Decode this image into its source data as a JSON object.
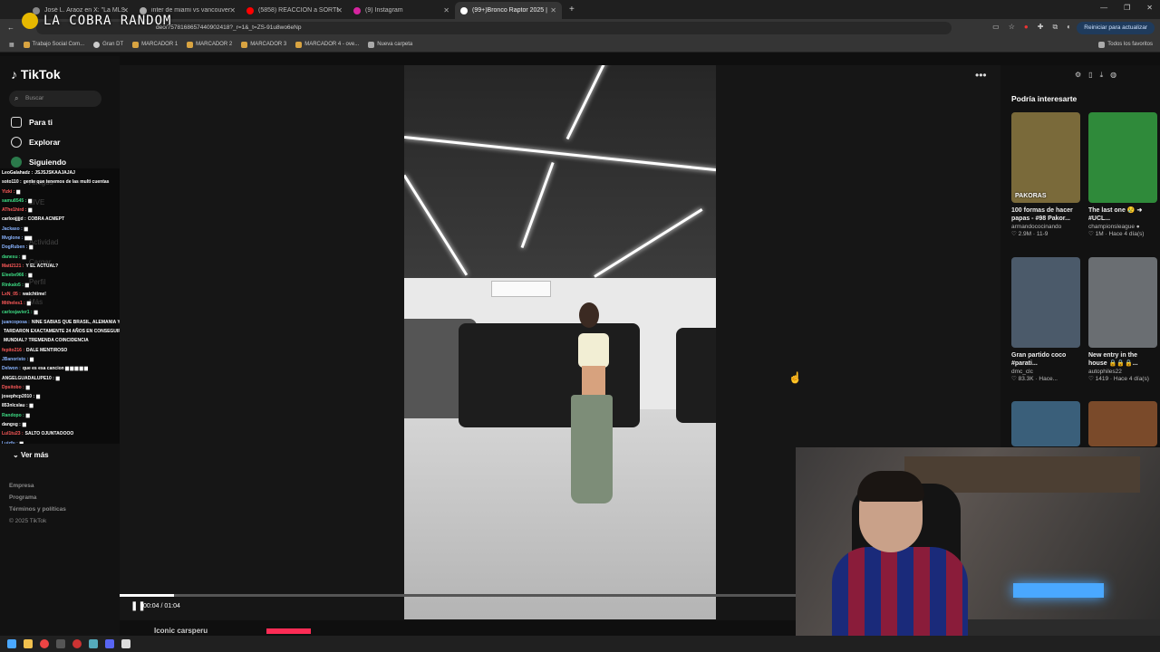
{
  "browser": {
    "tabs": [
      {
        "label": "José L. Araoz en X: \"La MLS",
        "color": "#888888"
      },
      {
        "label": "inter de miami vs vancouver - B",
        "color": "#aaaaaa"
      },
      {
        "label": "(5858) REACCION a SORTEO de",
        "color": "#ff0000"
      },
      {
        "label": "(9) Instagram",
        "color": "#d6249f"
      },
      {
        "label": "(99+)Bronco Raptor 2025 |",
        "color": "#ffffff"
      }
    ],
    "url": "deo/7578168657440902418?_r=1&_t=ZS-91u8wo6eNp",
    "update_button": "Reiniciar para actualizar",
    "bookmarks": [
      "Trabajo Social Com...",
      "Gran DT",
      "MARCADOR 1",
      "MARCADOR 2",
      "MARCADOR 3",
      "MARCADOR 4 - ove...",
      "Nueva carpeta"
    ],
    "all_favorites": "Todos los favoritos"
  },
  "stream_overlay": {
    "logo_text": "LA COBRA RANDOM"
  },
  "sidebar": {
    "logo": "TikTok",
    "search_placeholder": "Buscar",
    "nav": [
      {
        "label": "Para ti",
        "icon": "home-icon"
      },
      {
        "label": "Explorar",
        "icon": "compass-icon"
      },
      {
        "label": "Siguiendo",
        "icon": "following-icon"
      }
    ],
    "ghost_nav": [
      "Amigos",
      "LIVE",
      "Actividad",
      "Cargar",
      "Perfil",
      "Más"
    ],
    "ver_mas": "Ver más",
    "footer": [
      "Empresa",
      "Programa",
      "Términos y políticas"
    ],
    "copyright": "© 2025 TikTok"
  },
  "chat": [
    {
      "user": "LeoGalahadz :",
      "msg": "JSJSJSKAAJAJAJ",
      "color": "#ffffff"
    },
    {
      "user": "soto110 :",
      "msg": "gente que tenemos de las multi cuentas",
      "color": "#ffffff"
    },
    {
      "user": "Yizki :",
      "msg": "▆",
      "color": "#ff5a5a"
    },
    {
      "user": "samu8545 :",
      "msg": "▆",
      "color": "#3ddc84"
    },
    {
      "user": "AThe1hird :",
      "msg": "▆",
      "color": "#ff5a5a"
    },
    {
      "user": "carloojjjjd :",
      "msg": "COBRA ACMEPT",
      "color": "#ffffff"
    },
    {
      "user": "Jackaso :",
      "msg": "▆",
      "color": "#8ab4ff"
    },
    {
      "user": "Mvglone :",
      "msg": "▆▆",
      "color": "#8ab4ff"
    },
    {
      "user": "DogRuben :",
      "msg": "▆",
      "color": "#8ab4ff"
    },
    {
      "user": "danesu :",
      "msg": "▆",
      "color": "#3ddc84"
    },
    {
      "user": "Matt2121 :",
      "msg": "Y EL ACTUAL?",
      "color": "#ff5a5a"
    },
    {
      "user": "Eleebe966 :",
      "msg": "▆",
      "color": "#3ddc84"
    },
    {
      "user": "Rinkalo5 :",
      "msg": "▆",
      "color": "#3ddc84"
    },
    {
      "user": "LxN_05 :",
      "msg": "watchtime!",
      "color": "#ff5a5a"
    },
    {
      "user": "Mitheles1 :",
      "msg": "▆",
      "color": "#ff5a5a"
    },
    {
      "user": "carlosjavier1 :",
      "msg": "▆",
      "color": "#3ddc84"
    },
    {
      "user": "juancoposa :",
      "msg": "NINE SABIAS QUE BRASIL, ALEMANIA Y ITALIA",
      "color": "#8ab4ff"
    },
    {
      "user": "",
      "msg": "TARDARON EXACTAMENTE 24 AÑOS EN CONSEGUIR SU 4TO",
      "color": "#ffffff"
    },
    {
      "user": "",
      "msg": "MUNDIAL? TREMENDA COINCIDENCIA",
      "color": "#ffffff"
    },
    {
      "user": "fepito216 :",
      "msg": "DALE MENTIROSO",
      "color": "#ff5a5a"
    },
    {
      "user": "JBanoristo :",
      "msg": "▆",
      "color": "#8ab4ff"
    },
    {
      "user": "Delwon :",
      "msg": "que es esa cancion ▆ ▆ ▆ ▆ ▆",
      "color": "#8ab4ff"
    },
    {
      "user": "ANGELGUADALUPE10 :",
      "msg": "▆",
      "color": "#ffffff"
    },
    {
      "user": "Dpsitobo :",
      "msg": "▆",
      "color": "#ff5a5a"
    },
    {
      "user": "josephcp2010 :",
      "msg": "▆",
      "color": "#ffffff"
    },
    {
      "user": "853nlcslau :",
      "msg": "▆",
      "color": "#ffffff"
    },
    {
      "user": "Randopo :",
      "msg": "▆",
      "color": "#3ddc84"
    },
    {
      "user": "dangsg :",
      "msg": "▆",
      "color": "#ffffff"
    },
    {
      "user": "Lul1tu23 :",
      "msg": "SALTO OJUNTAOOOO",
      "color": "#ff5a5a"
    },
    {
      "user": "Luizfu :",
      "msg": "▆",
      "color": "#8ab4ff"
    }
  ],
  "player": {
    "time": "00:04 / 01:04",
    "progress": 0.08,
    "caption": "Iconic carsperu"
  },
  "recommendations": {
    "title": "Podría interesarte",
    "items": [
      {
        "title": "100 formas de hacer papas - #98 Pakor...",
        "author": "armandococinando",
        "stats": "♡ 2.9M · 11-9",
        "thumb_text": "PAKORAS",
        "bg": "#7a6a3a"
      },
      {
        "title": "The last one 😢 ➜ #UCL...",
        "author": "championsleague ●",
        "stats": "♡ 1M · Hace 4 día(s)",
        "thumb_text": "",
        "bg": "#2f8a3a"
      },
      {
        "title": "Gran partido coco #parati...",
        "author": "dmc_clc",
        "stats": "♡ 83.3K · Hace...",
        "thumb_text": "",
        "bg": "#4b5a6a"
      },
      {
        "title": "New entry in the house 🔒🔒🔒...",
        "author": "autophiles22",
        "stats": "♡ 1419 · Hace 4 día(s)",
        "thumb_text": "",
        "bg": "#6a6e72"
      },
      {
        "title": "",
        "author": "",
        "stats": "",
        "thumb_text": "",
        "bg": "#3a5f7a"
      },
      {
        "title": "",
        "author": "",
        "stats": "",
        "thumb_text": "",
        "bg": "#7a4a2a"
      }
    ]
  }
}
